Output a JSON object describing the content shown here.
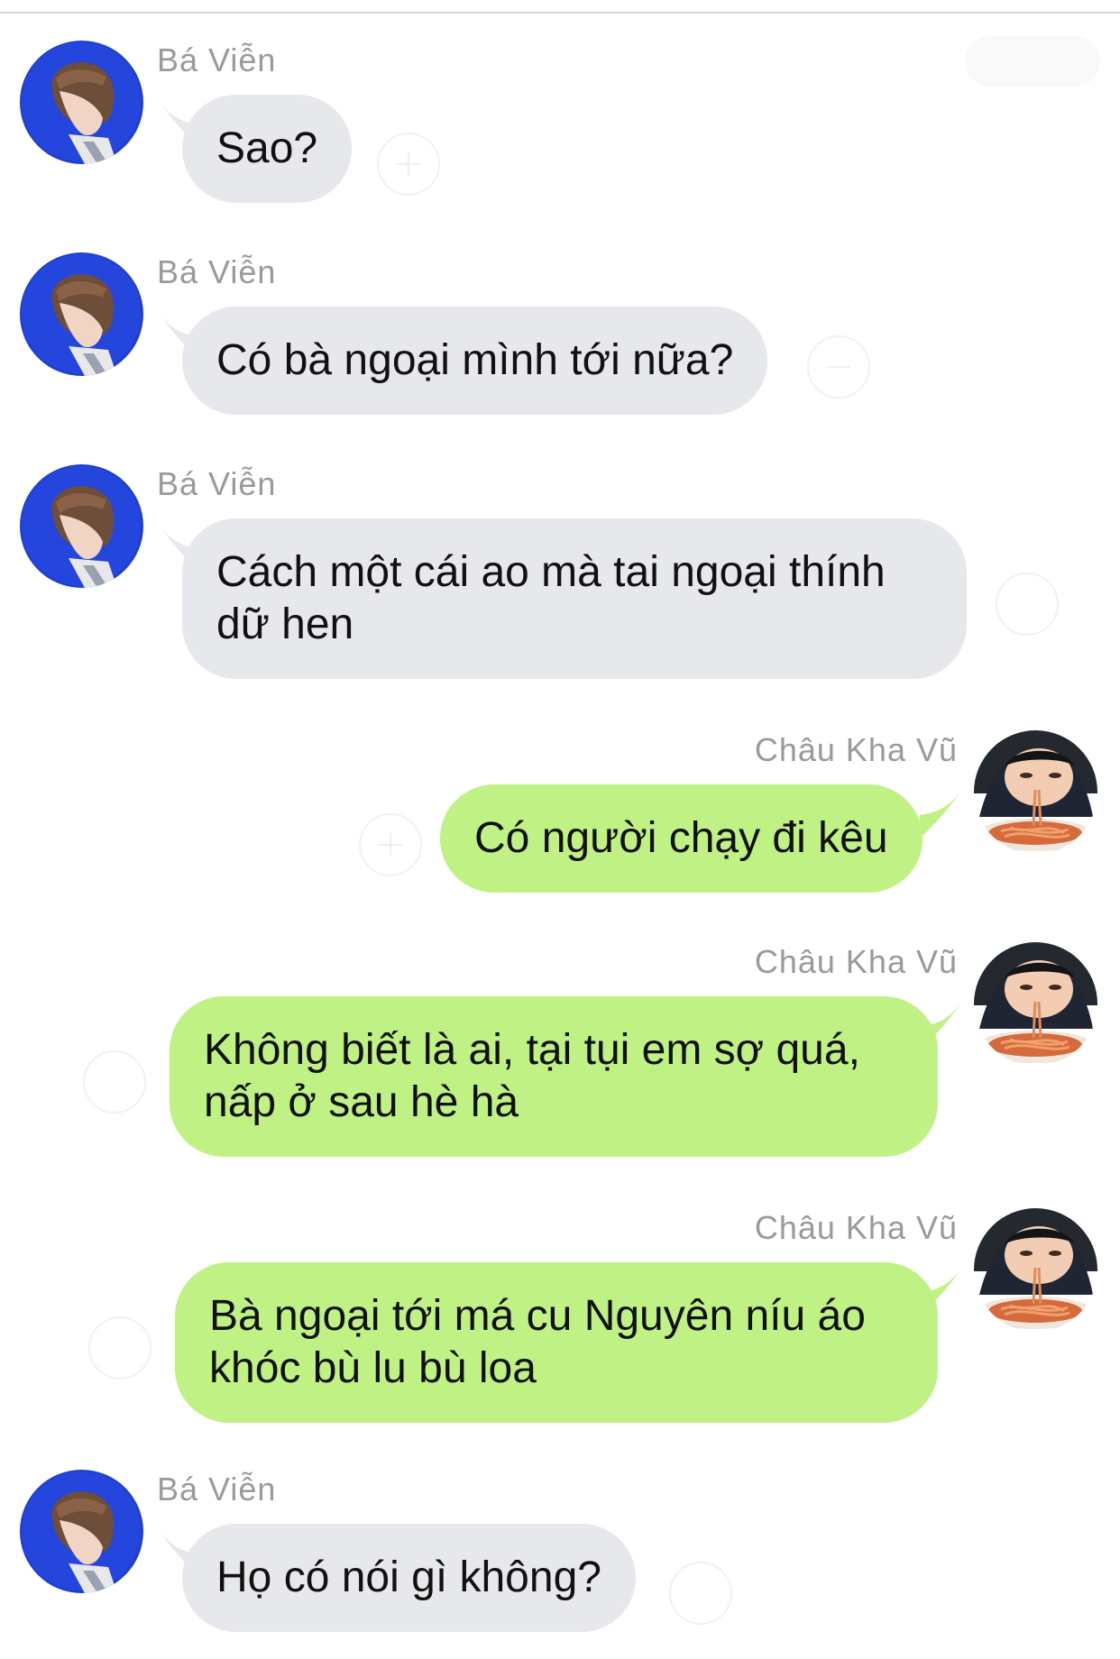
{
  "theme": {
    "incoming_bubble_color": "#e7e8ec",
    "outgoing_bubble_color": "#c0f185",
    "sender_name_color": "#9a9a9a",
    "background_color": "#ffffff"
  },
  "messages": [
    {
      "direction": "incoming",
      "sender": "Bá Viễn",
      "avatar": "profile-photo-blue-background",
      "text": "Sao?"
    },
    {
      "direction": "incoming",
      "sender": "Bá Viễn",
      "avatar": "profile-photo-blue-background",
      "text": "Có bà ngoại mình tới nữa?"
    },
    {
      "direction": "incoming",
      "sender": "Bá Viễn",
      "avatar": "profile-photo-blue-background",
      "text_lines": [
        "Cách một cái ao mà tai ngoại thính",
        "dữ hen"
      ]
    },
    {
      "direction": "outgoing",
      "sender": "Châu Kha Vũ",
      "avatar": "child-eating-spaghetti-photo",
      "text": "Có người chạy đi kêu"
    },
    {
      "direction": "outgoing",
      "sender": "Châu Kha Vũ",
      "avatar": "child-eating-spaghetti-photo",
      "text_lines": [
        "Không biết là ai, tại tụi em sợ quá,",
        "nấp ở sau hè hà"
      ]
    },
    {
      "direction": "outgoing",
      "sender": "Châu Kha Vũ",
      "avatar": "child-eating-spaghetti-photo",
      "text_lines": [
        "Bà ngoại tới má cu Nguyên níu áo",
        "khóc bù lu bù loa"
      ]
    },
    {
      "direction": "incoming",
      "sender": "Bá Viễn",
      "avatar": "profile-photo-blue-background",
      "text": "Họ có nói gì không?"
    }
  ]
}
